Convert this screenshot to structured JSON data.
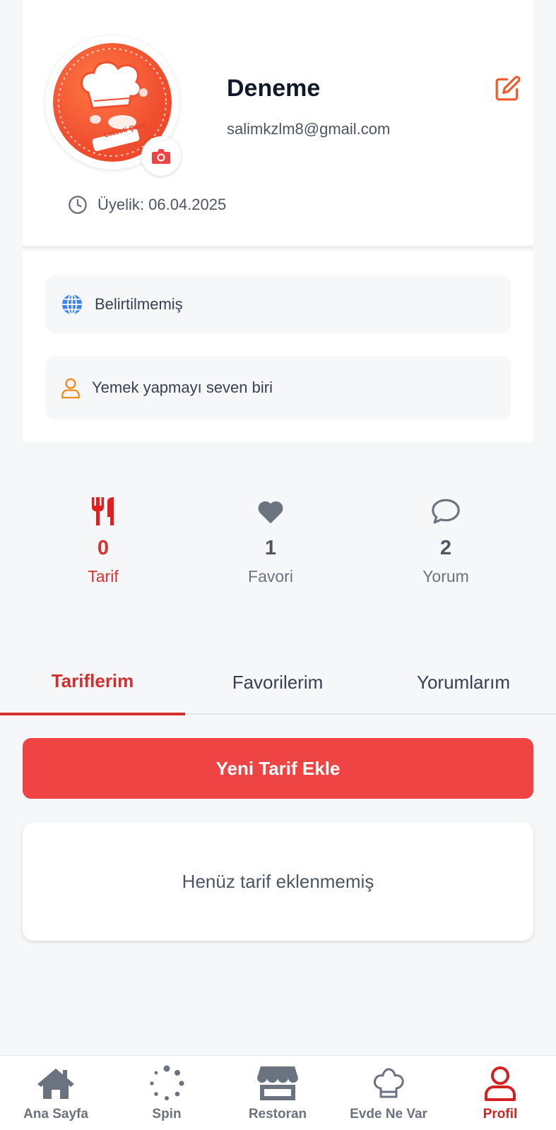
{
  "profile": {
    "name": "Deneme",
    "email": "salimkzlm8@gmail.com",
    "member_since": "Üyelik: 06.04.2025",
    "avatar_logo_text": "Lezzeti Çevir"
  },
  "info": {
    "location": "Belirtilmemiş",
    "bio": "Yemek yapmayı seven biri"
  },
  "stats": [
    {
      "icon": "fork-knife-icon",
      "value": "0",
      "label": "Tarif",
      "active": true
    },
    {
      "icon": "heart-icon",
      "value": "1",
      "label": "Favori",
      "active": false
    },
    {
      "icon": "comment-icon",
      "value": "2",
      "label": "Yorum",
      "active": false
    }
  ],
  "tabs": [
    {
      "label": "Tariflerim",
      "active": true
    },
    {
      "label": "Favorilerim",
      "active": false
    },
    {
      "label": "Yorumlarım",
      "active": false
    }
  ],
  "actions": {
    "add_recipe": "Yeni Tarif Ekle"
  },
  "empty_state": "Henüz tarif eklenmemiş",
  "bottom_nav": [
    {
      "icon": "home-icon",
      "label": "Ana Sayfa",
      "active": false
    },
    {
      "icon": "spin-icon",
      "label": "Spin",
      "active": false
    },
    {
      "icon": "store-icon",
      "label": "Restoran",
      "active": false
    },
    {
      "icon": "chef-hat-icon",
      "label": "Evde Ne Var",
      "active": false
    },
    {
      "icon": "user-icon",
      "label": "Profil",
      "active": true
    }
  ],
  "colors": {
    "accent": "#ef4444",
    "active_text": "#d42e2e",
    "background": "#f6f7f9",
    "edit_icon": "#f05a28",
    "bio_icon": "#f0891d",
    "globe_icon": "#3b82f6"
  }
}
